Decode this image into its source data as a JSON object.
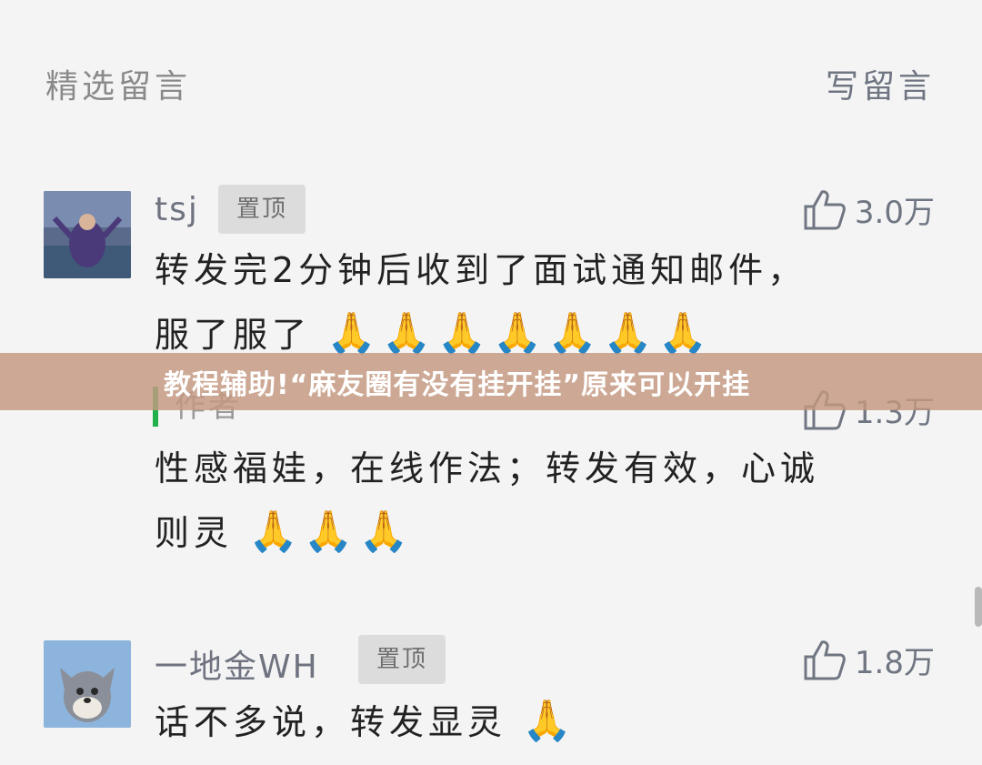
{
  "header": {
    "title": "精选留言",
    "write_label": "写留言"
  },
  "banner": {
    "text": "教程辅助!“麻友圈有没有挂开挂”原来可以开挂"
  },
  "comments": [
    {
      "name": "tsj",
      "pinned_label": "置顶",
      "likes": "3.0万",
      "text_line1": "转发完2分钟后收到了面试通知邮件，",
      "text_line2": "服了服了",
      "emoji": "🙏🙏🙏🙏🙏🙏🙏"
    },
    {
      "author_label": "作者",
      "likes": "1.3万",
      "text_line1": "性感福娃，在线作法；转发有效，心诚",
      "text_line2": "则灵",
      "emoji": "🙏🙏🙏"
    },
    {
      "name": "一地金WH",
      "pinned_label": "置顶",
      "likes": "1.8万",
      "text_line1": "话不多说，转发显灵",
      "emoji": "🙏"
    }
  ],
  "icons": {
    "like": "thumbs-up-icon"
  },
  "colors": {
    "background": "#f4f4f4",
    "banner": "#c49880",
    "author_bar": "#21b14c"
  }
}
